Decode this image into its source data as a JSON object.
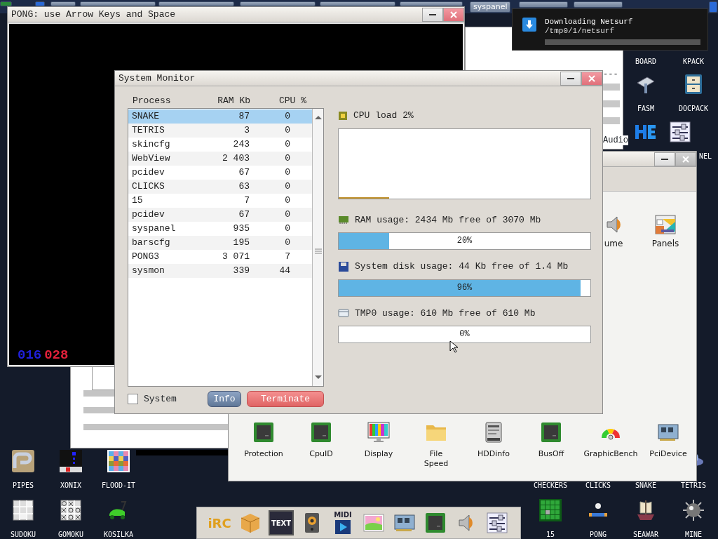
{
  "taskbar": {
    "buttons": [
      {
        "label": "syspanel"
      }
    ]
  },
  "notification": {
    "title": "Downloading Netsurf",
    "path": "/tmp0/1/netsurf",
    "level": 0
  },
  "pong_window": {
    "title": "PONG: use Arrow Keys and Space",
    "scores": [
      {
        "value": "016",
        "color": "#2020d8"
      },
      {
        "value": "028",
        "color": "#e0203a"
      }
    ]
  },
  "background_window": {
    "dashes": "---",
    "label": "Audio"
  },
  "system_monitor": {
    "title": "System Monitor",
    "columns": [
      "Process",
      "RAM Kb",
      "CPU %"
    ],
    "processes": [
      {
        "name": "SNAKE",
        "ram": "87",
        "cpu": "0",
        "selected": true
      },
      {
        "name": "TETRIS",
        "ram": "3",
        "cpu": "0",
        "selected": false
      },
      {
        "name": "skincfg",
        "ram": "243",
        "cpu": "0",
        "selected": false
      },
      {
        "name": "WebView",
        "ram": "2 403",
        "cpu": "0",
        "selected": false
      },
      {
        "name": "pcidev",
        "ram": "67",
        "cpu": "0",
        "selected": false
      },
      {
        "name": "CLICKS",
        "ram": "63",
        "cpu": "0",
        "selected": false
      },
      {
        "name": "15",
        "ram": "7",
        "cpu": "0",
        "selected": false
      },
      {
        "name": "pcidev",
        "ram": "67",
        "cpu": "0",
        "selected": false
      },
      {
        "name": "syspanel",
        "ram": "935",
        "cpu": "0",
        "selected": false
      },
      {
        "name": "barscfg",
        "ram": "195",
        "cpu": "0",
        "selected": false
      },
      {
        "name": "PONG3",
        "ram": "3 071",
        "cpu": "7",
        "selected": false
      },
      {
        "name": "sysmon",
        "ram": "339",
        "cpu": "44",
        "selected": false
      }
    ],
    "system_checkbox": {
      "label": "System",
      "checked": false
    },
    "buttons": [
      {
        "label": "Info",
        "kind": "info"
      },
      {
        "label": "Terminate",
        "kind": "danger"
      }
    ],
    "cpu": {
      "label": "CPU load 2%"
    },
    "meters": [
      {
        "kind": "ram",
        "label": "RAM usage: 2434 Mb free of 3070 Mb",
        "level": 0.2,
        "reading": "20%"
      },
      {
        "kind": "disk",
        "label": "System disk usage: 44 Kb free of 1.4 Mb",
        "level": 0.96,
        "reading": "96%"
      },
      {
        "kind": "tmp",
        "label": "TMP0 usage: 610 Mb free of 610 Mb",
        "level": 0,
        "reading": "0%"
      }
    ]
  },
  "syspanel_window": {
    "top_items": [
      {
        "label": "ume"
      },
      {
        "label": "Panels"
      }
    ],
    "items": [
      {
        "label": "Protection"
      },
      {
        "label": "CpuID"
      },
      {
        "label": "Display"
      },
      {
        "label": "File Speed"
      },
      {
        "label": "HDDinfo"
      },
      {
        "label": "BusOff"
      },
      {
        "label": "GraphicBench"
      },
      {
        "label": "PciDevice"
      }
    ]
  },
  "desktop_icons": [
    {
      "label": "BOARD"
    },
    {
      "label": "KPACK"
    },
    {
      "label": "FASM"
    },
    {
      "label": "DOCPACK"
    },
    {
      "label": "NEL"
    },
    {
      "label": "CHECKERS"
    },
    {
      "label": "CLICKS"
    },
    {
      "label": "SNAKE"
    },
    {
      "label": "TETRIS"
    },
    {
      "label": "15"
    },
    {
      "label": "PONG"
    },
    {
      "label": "SEAWAR"
    },
    {
      "label": "MINE"
    },
    {
      "label": "PIPES"
    },
    {
      "label": "XONIX"
    },
    {
      "label": "FLOOD-IT"
    },
    {
      "label": "SUDOKU"
    },
    {
      "label": "GOMOKU"
    },
    {
      "label": "KOSILKA"
    }
  ],
  "dock": [
    {
      "kind": "irc",
      "label": "iRC"
    },
    {
      "kind": "box"
    },
    {
      "kind": "text",
      "label": "TEXT"
    },
    {
      "kind": "speakerbox"
    },
    {
      "kind": "midi",
      "label": "MIDI"
    },
    {
      "kind": "image"
    },
    {
      "kind": "card"
    },
    {
      "kind": "chip"
    },
    {
      "kind": "volume"
    },
    {
      "kind": "sliders"
    }
  ]
}
